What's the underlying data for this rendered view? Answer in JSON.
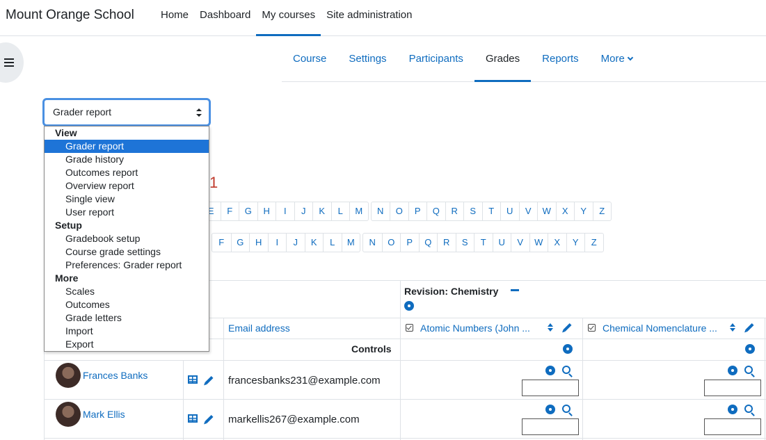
{
  "site": {
    "name": "Mount Orange School"
  },
  "topnav": {
    "items": [
      "Home",
      "Dashboard",
      "My courses",
      "Site administration"
    ]
  },
  "secnav": {
    "items": [
      "Course",
      "Settings",
      "Participants",
      "Grades",
      "Reports",
      "More"
    ]
  },
  "report_select": {
    "value": "Grader report",
    "groups": [
      {
        "label": "View",
        "options": [
          "Grader report",
          "Grade history",
          "Outcomes report",
          "Overview report",
          "Single view",
          "User report"
        ]
      },
      {
        "label": "Setup",
        "options": [
          "Gradebook setup",
          "Course grade settings",
          "Preferences: Grader report"
        ]
      },
      {
        "label": "More",
        "options": [
          "Scales",
          "Outcomes",
          "Grade letters",
          "Import",
          "Export"
        ]
      }
    ]
  },
  "heading_fragment": "1",
  "firstname_letters": {
    "group1": [
      "E",
      "F",
      "G",
      "H",
      "I",
      "J",
      "K",
      "L",
      "M"
    ],
    "group2": [
      "N",
      "O",
      "P",
      "Q",
      "R",
      "S",
      "T",
      "U",
      "V",
      "W",
      "X",
      "Y",
      "Z"
    ]
  },
  "lastname_letters": {
    "group1": [
      "F",
      "G",
      "H",
      "I",
      "J",
      "K",
      "L",
      "M"
    ],
    "group2": [
      "N",
      "O",
      "P",
      "Q",
      "R",
      "S",
      "T",
      "U",
      "V",
      "W",
      "X",
      "Y",
      "Z"
    ]
  },
  "table": {
    "category": "Revision: Chemistry",
    "email_header": "Email address",
    "columns": [
      "Atomic Numbers (John ...",
      "Chemical Nomenclature ..."
    ],
    "controls_label": "Controls",
    "rows": [
      {
        "name": "Frances Banks",
        "email": "francesbanks231@example.com"
      },
      {
        "name": "Mark Ellis",
        "email": "markellis267@example.com"
      }
    ]
  },
  "colors": {
    "accent": "#0f6cbf",
    "selected": "#1e74d7",
    "focus": "#4a90e2"
  }
}
